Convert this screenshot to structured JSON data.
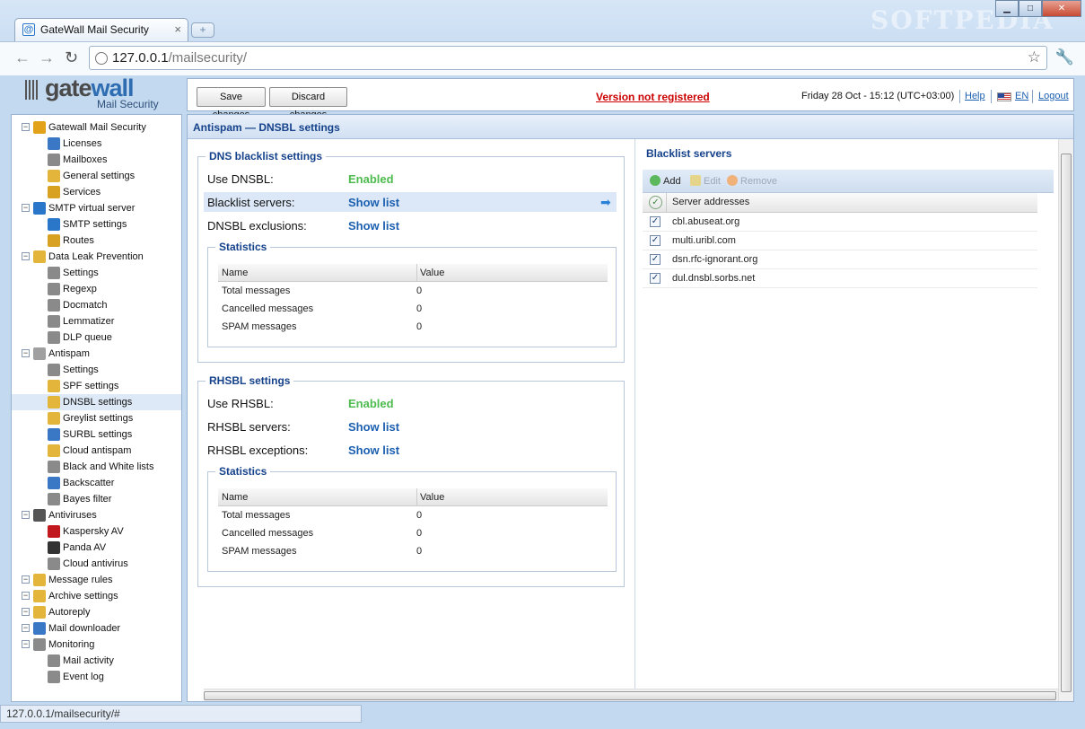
{
  "browser": {
    "tab_title": "GateWall Mail Security",
    "tab_favicon": "@",
    "tab_close": "×",
    "new_tab": "+",
    "url_host": "127.0.0.1",
    "url_path": "/mailsecurity/",
    "status_url": "127.0.0.1/mailsecurity/#",
    "watermark": "SOFTPEDIA"
  },
  "logo": {
    "part1": "gate",
    "part2": "wall",
    "sub": "Mail Security"
  },
  "topbar": {
    "save": "Save changes",
    "discard": "Discard changes",
    "warning": "Version not registered",
    "datetime": "Friday 28 Oct - 15:12 (UTC+03:00)",
    "help": "Help",
    "lang": "EN",
    "logout": "Logout"
  },
  "sidebar": {
    "items": [
      {
        "label": "Gatewall Mail Security",
        "level": 0,
        "color": "#e2a31b"
      },
      {
        "label": "Licenses",
        "level": 1,
        "color": "#3a78c6"
      },
      {
        "label": "Mailboxes",
        "level": 1,
        "color": "#8a8a8a"
      },
      {
        "label": "General settings",
        "level": 1,
        "color": "#e3b53a"
      },
      {
        "label": "Services",
        "level": 1,
        "color": "#d9a121"
      },
      {
        "label": "SMTP virtual server",
        "level": 0,
        "color": "#2a77c9"
      },
      {
        "label": "SMTP settings",
        "level": 1,
        "color": "#2a77c9"
      },
      {
        "label": "Routes",
        "level": 1,
        "color": "#d9a121"
      },
      {
        "label": "Data Leak Prevention",
        "level": 0,
        "color": "#e3b53a"
      },
      {
        "label": "Settings",
        "level": 1,
        "color": "#8a8a8a"
      },
      {
        "label": "Regexp",
        "level": 1,
        "color": "#8a8a8a"
      },
      {
        "label": "Docmatch",
        "level": 1,
        "color": "#8a8a8a"
      },
      {
        "label": "Lemmatizer",
        "level": 1,
        "color": "#8a8a8a"
      },
      {
        "label": "DLP queue",
        "level": 1,
        "color": "#8a8a8a"
      },
      {
        "label": "Antispam",
        "level": 0,
        "color": "#a0a0a0"
      },
      {
        "label": "Settings",
        "level": 1,
        "color": "#8a8a8a"
      },
      {
        "label": "SPF settings",
        "level": 1,
        "color": "#e3b53a"
      },
      {
        "label": "DNSBL settings",
        "level": 1,
        "color": "#e3b53a"
      },
      {
        "label": "Greylist settings",
        "level": 1,
        "color": "#e3b53a"
      },
      {
        "label": "SURBL settings",
        "level": 1,
        "color": "#3a78c6"
      },
      {
        "label": "Cloud antispam",
        "level": 1,
        "color": "#e3b53a"
      },
      {
        "label": "Black and White lists",
        "level": 1,
        "color": "#8a8a8a"
      },
      {
        "label": "Backscatter",
        "level": 1,
        "color": "#3a78c6"
      },
      {
        "label": "Bayes filter",
        "level": 1,
        "color": "#8a8a8a"
      },
      {
        "label": "Antiviruses",
        "level": 0,
        "color": "#555555"
      },
      {
        "label": "Kaspersky AV",
        "level": 1,
        "color": "#c0181c"
      },
      {
        "label": "Panda AV",
        "level": 1,
        "color": "#333333"
      },
      {
        "label": "Cloud antivirus",
        "level": 1,
        "color": "#8a8a8a"
      },
      {
        "label": "Message rules",
        "level": 0,
        "color": "#e3b53a"
      },
      {
        "label": "Archive settings",
        "level": 0,
        "color": "#e3b53a"
      },
      {
        "label": "Autoreply",
        "level": 0,
        "color": "#e3b53a"
      },
      {
        "label": "Mail downloader",
        "level": 0,
        "color": "#3a78c6"
      },
      {
        "label": "Monitoring",
        "level": 0,
        "color": "#8a8a8a"
      },
      {
        "label": "Mail activity",
        "level": 1,
        "color": "#8a8a8a"
      },
      {
        "label": "Event log",
        "level": 1,
        "color": "#8a8a8a"
      }
    ]
  },
  "main": {
    "title": "Antispam — DNSBL settings",
    "dns": {
      "legend": "DNS blacklist settings",
      "use_label": "Use DNSBL:",
      "use_value": "Enabled",
      "servers_label": "Blacklist servers:",
      "servers_value": "Show list",
      "excl_label": "DNSBL exclusions:",
      "excl_value": "Show list",
      "stats_legend": "Statistics",
      "col_name": "Name",
      "col_value": "Value",
      "rows": [
        {
          "name": "Total messages",
          "value": "0"
        },
        {
          "name": "Cancelled messages",
          "value": "0"
        },
        {
          "name": "SPAM messages",
          "value": "0"
        }
      ]
    },
    "rhsbl": {
      "legend": "RHSBL settings",
      "use_label": "Use RHSBL:",
      "use_value": "Enabled",
      "servers_label": "RHSBL servers:",
      "servers_value": "Show list",
      "excl_label": "RHSBL exceptions:",
      "excl_value": "Show list",
      "stats_legend": "Statistics",
      "col_name": "Name",
      "col_value": "Value",
      "rows": [
        {
          "name": "Total messages",
          "value": "0"
        },
        {
          "name": "Cancelled messages",
          "value": "0"
        },
        {
          "name": "SPAM messages",
          "value": "0"
        }
      ]
    },
    "blacklist": {
      "legend": "Blacklist servers",
      "add": "Add",
      "edit": "Edit",
      "remove": "Remove",
      "col": "Server addresses",
      "rows": [
        "cbl.abuseat.org",
        "multi.uribl.com",
        "dsn.rfc-ignorant.org",
        "dul.dnsbl.sorbs.net"
      ]
    }
  }
}
